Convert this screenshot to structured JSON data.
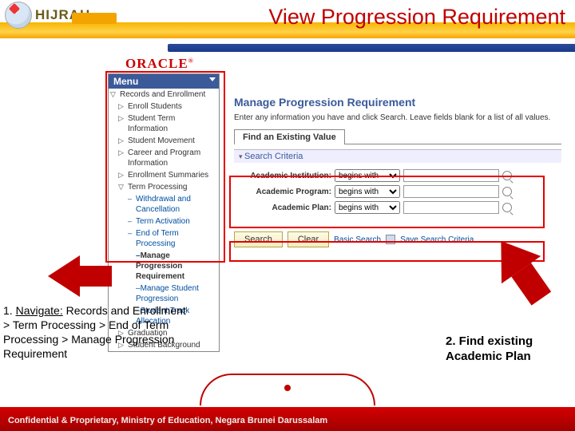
{
  "header": {
    "brand": "HIJRAH",
    "title": "View Progression Requirement"
  },
  "oracle": "ORACLE",
  "menu": {
    "header": "Menu",
    "items": [
      {
        "label": "Records and Enrollment",
        "cls": "o"
      },
      {
        "label": "Enroll Students",
        "cls": "t sub"
      },
      {
        "label": "Student Term Information",
        "cls": "t sub"
      },
      {
        "label": "Student Movement",
        "cls": "t sub"
      },
      {
        "label": "Career and Program Information",
        "cls": "t sub"
      },
      {
        "label": "Enrollment Summaries",
        "cls": "t sub"
      },
      {
        "label": "Term Processing",
        "cls": "o sub"
      },
      {
        "label": "Withdrawal and Cancellation",
        "cls": "t sub2"
      },
      {
        "label": "Term Activation",
        "cls": "t sub2"
      },
      {
        "label": "End of Term Processing",
        "cls": "o sub2"
      },
      {
        "label": "Manage Progression Requirement",
        "cls": "sub2 sel"
      },
      {
        "label": "Manage Student Progression",
        "cls": "sub2"
      },
      {
        "label": "Student Track Allocation",
        "cls": "sub2"
      },
      {
        "label": "Graduation",
        "cls": "t sub"
      },
      {
        "label": "Student Background",
        "cls": "t sub"
      }
    ]
  },
  "page": {
    "title": "Manage Progression Requirement",
    "instruction": "Enter any information you have and click Search. Leave fields blank for a list of all values.",
    "tab": "Find an Existing Value",
    "search_header": "Search Criteria",
    "fields": [
      {
        "label": "Academic Institution:",
        "op": "begins with"
      },
      {
        "label": "Academic Program:",
        "op": "begins with"
      },
      {
        "label": "Academic Plan:",
        "op": "begins with"
      }
    ],
    "search_btn": "Search",
    "clear_btn": "Clear",
    "basic_link": "Basic Search",
    "save_link": "Save Search Criteria"
  },
  "notes": {
    "n1_a": "1. ",
    "n1_nav": "Navigate:",
    "n1_b": " Records and Enrollment > Term Processing > End of Term Processing > Manage Progression Requirement",
    "n2": "2. Find existing Academic Plan"
  },
  "footer": "Confidential & Proprietary, Ministry of Education, Negara Brunei Darussalam"
}
